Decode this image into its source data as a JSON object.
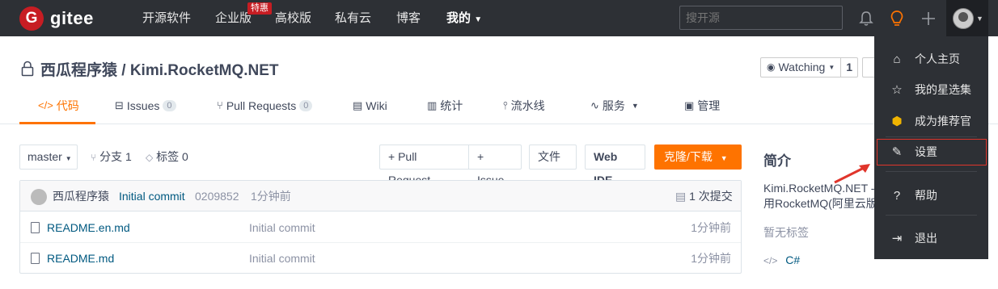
{
  "topnav": {
    "brand": "gitee",
    "logo_letter": "G",
    "items": [
      "开源软件",
      "企业版",
      "高校版",
      "私有云",
      "博客"
    ],
    "mine": "我的",
    "badge": "特惠",
    "search_placeholder": "搜开源"
  },
  "repo": {
    "title": "西瓜程序猿 / Kimi.RocketMQ.NET",
    "watch_label": "Watching",
    "watch_count": "1"
  },
  "tabs": [
    {
      "label": "代码"
    },
    {
      "label": "Issues",
      "count": "0"
    },
    {
      "label": "Pull Requests",
      "count": "0"
    },
    {
      "label": "Wiki"
    },
    {
      "label": "统计"
    },
    {
      "label": "流水线"
    },
    {
      "label": "服务"
    },
    {
      "label": "管理"
    }
  ],
  "toolbar": {
    "branch": "master",
    "branches": "分支 1",
    "tags": "标签 0",
    "pull_request": "+ Pull Request",
    "issue": "+ Issue",
    "file": "文件",
    "webide": "Web IDE",
    "clone": "克隆/下载"
  },
  "commit": {
    "author": "西瓜程序猿",
    "message": "Initial commit",
    "hash": "0209852",
    "time": "1分钟前",
    "count": "1 次提交"
  },
  "files": [
    {
      "name": "README.en.md",
      "msg": "Initial commit",
      "time": "1分钟前"
    },
    {
      "name": "README.md",
      "msg": "Initial commit",
      "time": "1分钟前"
    }
  ],
  "sidebar": {
    "heading": "简介",
    "desc_line1": "Kimi.RocketMQ.NET -",
    "desc_line2": "用RocketMQ(阿里云版",
    "no_tags": "暂无标签",
    "lang": "C#"
  },
  "dropdown": {
    "items": [
      "个人主页",
      "我的星选集",
      "成为推荐官",
      "设置",
      "帮助",
      "退出"
    ]
  },
  "colors": {
    "accent": "#fe7300",
    "nav_bg": "#2d3035",
    "brand_red": "#c71d23",
    "highlight": "#e0352b"
  }
}
